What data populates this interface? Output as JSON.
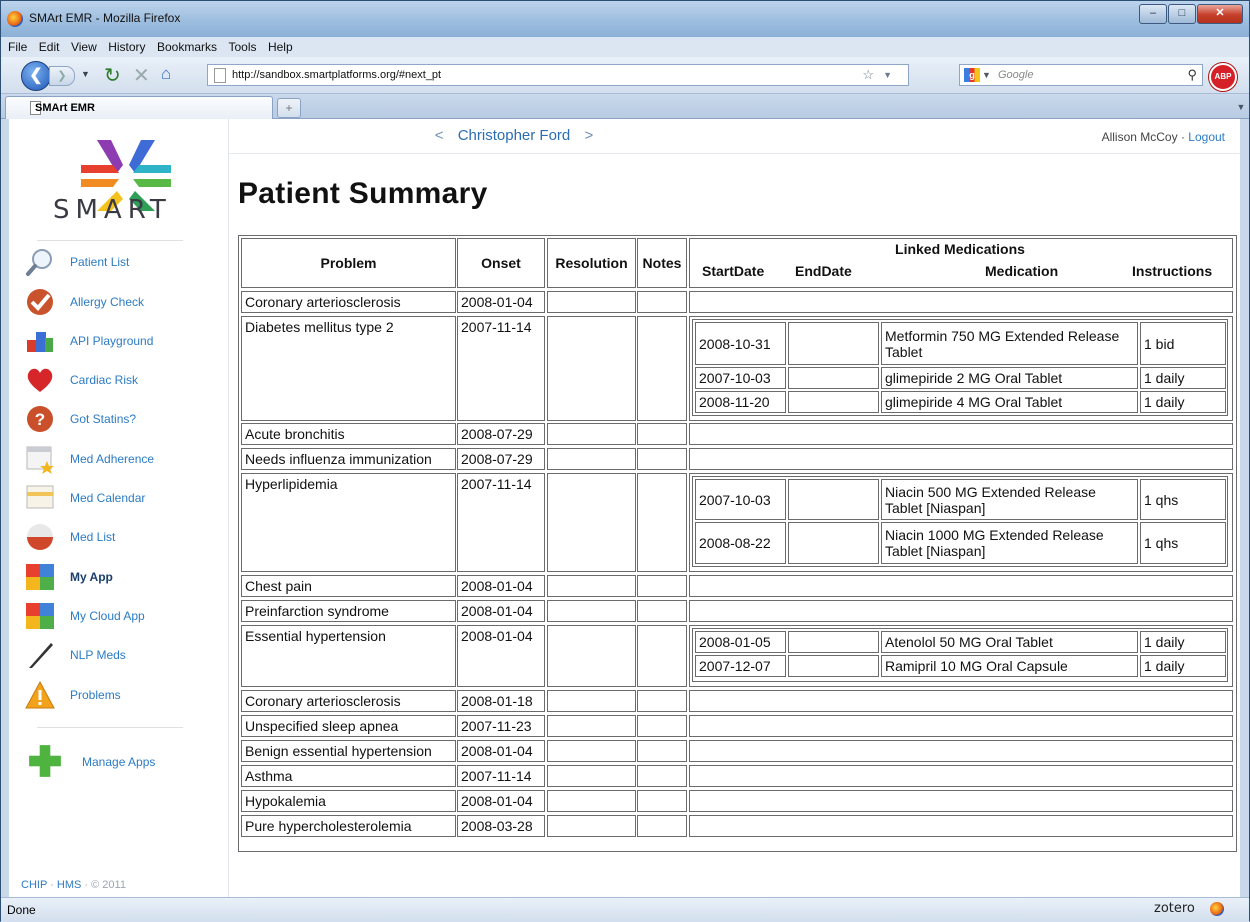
{
  "window": {
    "title": "SMArt EMR - Mozilla Firefox"
  },
  "menu": [
    "File",
    "Edit",
    "View",
    "History",
    "Bookmarks",
    "Tools",
    "Help"
  ],
  "address": {
    "url": "http://sandbox.smartplatforms.org/#next_pt",
    "search_placeholder": "Google"
  },
  "tab": {
    "label": "SMArt EMR"
  },
  "status": {
    "text": "Done",
    "zotero": "zotero"
  },
  "sidebar": {
    "logo_text": "SMART",
    "items": [
      {
        "label": "Patient List",
        "icon": "magnifier-icon"
      },
      {
        "label": "Allergy Check",
        "icon": "checkmark-icon"
      },
      {
        "label": "API Playground",
        "icon": "blocks-icon"
      },
      {
        "label": "Cardiac Risk",
        "icon": "heart-icon"
      },
      {
        "label": "Got Statins?",
        "icon": "question-icon"
      },
      {
        "label": "Med Adherence",
        "icon": "calendar-star-icon"
      },
      {
        "label": "Med Calendar",
        "icon": "calendar-icon"
      },
      {
        "label": "Med List",
        "icon": "pill-icon"
      },
      {
        "label": "My App",
        "icon": "app-tiles-icon"
      },
      {
        "label": "My Cloud App",
        "icon": "app-tiles-icon"
      },
      {
        "label": "NLP Meds",
        "icon": "pen-icon"
      },
      {
        "label": "Problems",
        "icon": "warning-icon"
      }
    ],
    "manage": {
      "label": "Manage Apps",
      "icon": "plus-icon"
    },
    "footer": {
      "chip": "CHIP",
      "hms": "HMS",
      "copyright": "© 2011"
    }
  },
  "header": {
    "prev": "<",
    "next": ">",
    "patient_name": "Christopher Ford",
    "user": "Allison McCoy",
    "logout": "Logout"
  },
  "page_title": "Patient Summary",
  "table": {
    "headers": {
      "problem": "Problem",
      "onset": "Onset",
      "resolution": "Resolution",
      "notes": "Notes",
      "linked": "Linked Medications",
      "startdate": "StartDate",
      "enddate": "EndDate",
      "medication": "Medication",
      "instructions": "Instructions"
    },
    "rows": [
      {
        "problem": "Coronary arteriosclerosis",
        "onset": "2008-01-04",
        "meds": []
      },
      {
        "problem": "Diabetes mellitus type 2",
        "onset": "2007-11-14",
        "meds": [
          {
            "start": "2008-10-31",
            "end": "",
            "med": "Metformin 750 MG Extended Release Tablet",
            "instr": "1 bid"
          },
          {
            "start": "2007-10-03",
            "end": "",
            "med": "glimepiride 2 MG Oral Tablet",
            "instr": "1 daily"
          },
          {
            "start": "2008-11-20",
            "end": "",
            "med": "glimepiride 4 MG Oral Tablet",
            "instr": "1 daily"
          }
        ]
      },
      {
        "problem": "Acute bronchitis",
        "onset": "2008-07-29",
        "meds": []
      },
      {
        "problem": "Needs influenza immunization",
        "onset": "2008-07-29",
        "meds": []
      },
      {
        "problem": "Hyperlipidemia",
        "onset": "2007-11-14",
        "meds": [
          {
            "start": "2007-10-03",
            "end": "",
            "med": "Niacin 500 MG Extended Release Tablet [Niaspan]",
            "instr": "1 qhs"
          },
          {
            "start": "2008-08-22",
            "end": "",
            "med": "Niacin 1000 MG Extended Release Tablet [Niaspan]",
            "instr": "1 qhs"
          }
        ]
      },
      {
        "problem": "Chest pain",
        "onset": "2008-01-04",
        "meds": []
      },
      {
        "problem": "Preinfarction syndrome",
        "onset": "2008-01-04",
        "meds": []
      },
      {
        "problem": "Essential hypertension",
        "onset": "2008-01-04",
        "meds": [
          {
            "start": "2008-01-05",
            "end": "",
            "med": "Atenolol 50 MG Oral Tablet",
            "instr": "1 daily"
          },
          {
            "start": "2007-12-07",
            "end": "",
            "med": "Ramipril 10 MG Oral Capsule",
            "instr": "1 daily"
          }
        ]
      },
      {
        "problem": "Coronary arteriosclerosis",
        "onset": "2008-01-18",
        "meds": []
      },
      {
        "problem": "Unspecified sleep apnea",
        "onset": "2007-11-23",
        "meds": []
      },
      {
        "problem": "Benign essential hypertension",
        "onset": "2008-01-04",
        "meds": []
      },
      {
        "problem": "Asthma",
        "onset": "2007-11-14",
        "meds": []
      },
      {
        "problem": "Hypokalemia",
        "onset": "2008-01-04",
        "meds": []
      },
      {
        "problem": "Pure hypercholesterolemia",
        "onset": "2008-03-28",
        "meds": []
      }
    ]
  }
}
